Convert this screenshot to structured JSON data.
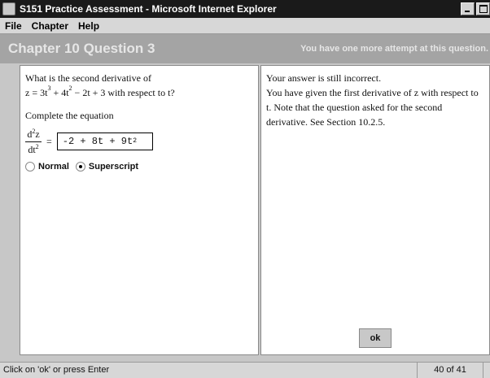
{
  "window": {
    "title": "S151 Practice Assessment - Microsoft Internet Explorer"
  },
  "menu": [
    "File",
    "Chapter",
    "Help"
  ],
  "header": {
    "title": "Chapter 10 Question 3",
    "status": "You have one more attempt at this question."
  },
  "question": {
    "line1": "What is the second derivative of",
    "expr_prefix": "z = 3t",
    "exp1": "3",
    "expr_mid": " + 4t",
    "exp2": "2",
    "expr_suffix": " − 2t + 3 with respect to t?",
    "instruction": "Complete the equation",
    "frac_num_d": "d",
    "frac_num_exp": "2",
    "frac_num_var": "z",
    "frac_den_dt": "dt",
    "frac_den_exp": "2",
    "equals": "=",
    "answer_base": "-2 + 8t + 9t",
    "answer_exp": "2"
  },
  "mode": {
    "options": [
      "Normal",
      "Superscript"
    ],
    "selected": "Superscript"
  },
  "feedback": {
    "line1": "Your answer is still incorrect.",
    "line2": "You have given the first derivative of z with respect to t. Note that the question asked for the second derivative. See Section 10.2.5."
  },
  "buttons": {
    "ok": "ok"
  },
  "status": {
    "text": "Click on 'ok' or press Enter",
    "count": "40 of 41"
  }
}
